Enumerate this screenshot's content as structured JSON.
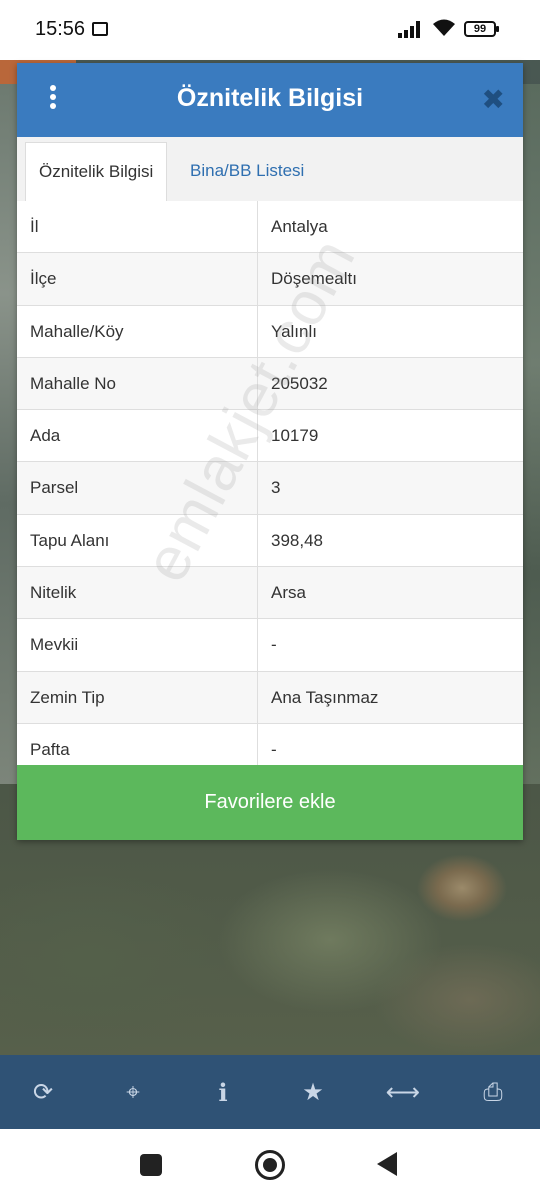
{
  "status_bar": {
    "time": "15:56",
    "battery": "99"
  },
  "dialog": {
    "title": "Öznitelik Bilgisi",
    "close_glyph": "✖",
    "tabs": [
      {
        "label": "Öznitelik Bilgisi",
        "active": true
      },
      {
        "label": "Bina/BB Listesi",
        "active": false
      }
    ],
    "rows": [
      {
        "key": "İl",
        "value": "Antalya"
      },
      {
        "key": "İlçe",
        "value": "Döşemealtı"
      },
      {
        "key": "Mahalle/Köy",
        "value": "Yalınlı"
      },
      {
        "key": "Mahalle No",
        "value": "205032"
      },
      {
        "key": "Ada",
        "value": "10179"
      },
      {
        "key": "Parsel",
        "value": "3"
      },
      {
        "key": "Tapu Alanı",
        "value": "398,48"
      },
      {
        "key": "Nitelik",
        "value": "Arsa"
      },
      {
        "key": "Mevkii",
        "value": "-"
      },
      {
        "key": "Zemin Tip",
        "value": "Ana Taşınmaz"
      },
      {
        "key": "Pafta",
        "value": "-"
      }
    ],
    "favorite_button": "Favorilere ekle"
  },
  "watermark": "emlakjet.com",
  "toolbar": {
    "items": [
      {
        "name": "refresh-icon",
        "glyph": "⟳"
      },
      {
        "name": "crosshair-icon",
        "glyph": "⌖"
      },
      {
        "name": "info-icon",
        "glyph": "i"
      },
      {
        "name": "star-icon",
        "glyph": "★"
      },
      {
        "name": "measure-icon",
        "glyph": "⟷"
      },
      {
        "name": "print-icon",
        "glyph": "⎙"
      }
    ]
  },
  "colors": {
    "header": "#3a7bbf",
    "favorite": "#5cb85c",
    "toolbar": "#2f5275",
    "tab_link": "#2f6fb0"
  }
}
